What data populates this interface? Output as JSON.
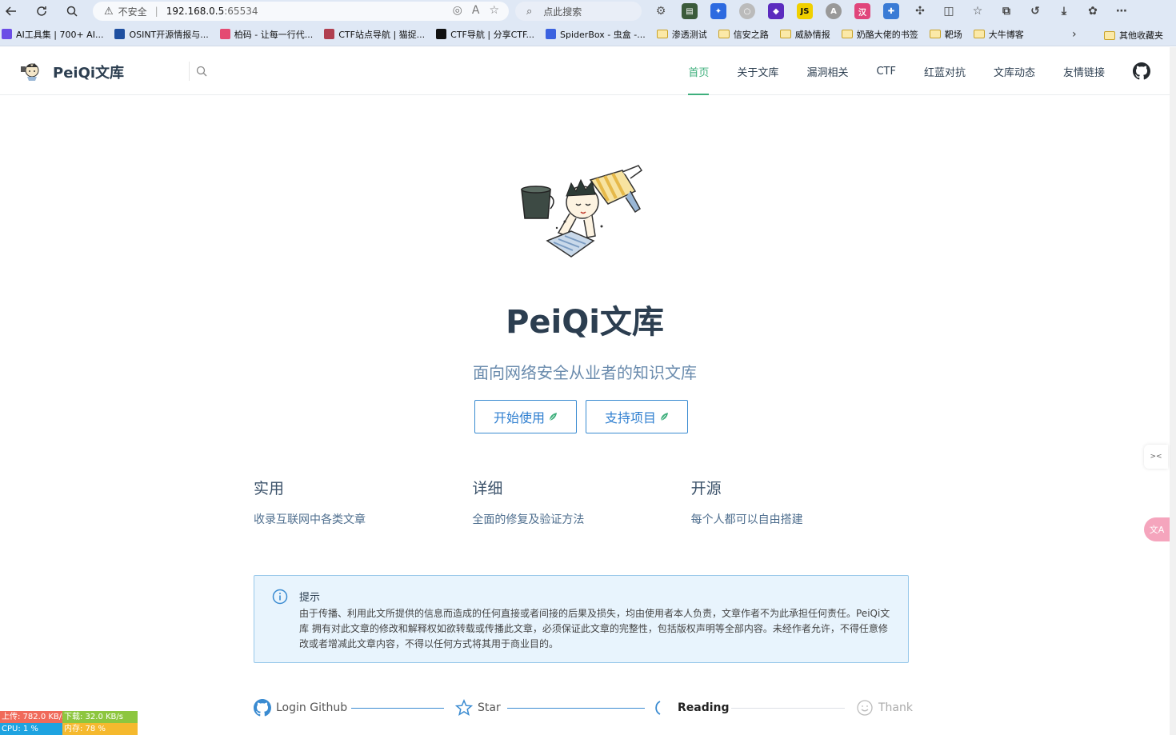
{
  "browser": {
    "security_label": "不安全",
    "url_host": "192.168.0.5",
    "url_port": ":65534",
    "search_placeholder": "点此搜索",
    "bookmarks": [
      {
        "label": "AI工具集 | 700+ AI...",
        "color": "#6b4de6"
      },
      {
        "label": "OSINT开源情报与...",
        "color": "#1e4fa0"
      },
      {
        "label": "柏码 - 让每一行代...",
        "color": "#e44b72"
      },
      {
        "label": "CTF站点导航 | 猫捉...",
        "color": "#b04050"
      },
      {
        "label": "CTF导航 | 分享CTF...",
        "color": "#111111"
      },
      {
        "label": "SpiderBox - 虫盒 -...",
        "color": "#3b62e0"
      }
    ],
    "folders": [
      "渗透测试",
      "信安之路",
      "威胁情报",
      "奶酪大佬的书签",
      "靶场",
      "大牛博客"
    ],
    "other_bookmarks": "其他收藏夹"
  },
  "header": {
    "site_title": "PeiQi文库",
    "nav": [
      "首页",
      "关于文库",
      "漏洞相关",
      "CTF",
      "红蓝对抗",
      "文库动态",
      "友情链接"
    ]
  },
  "hero": {
    "title": "PeiQi文库",
    "description": "面向网络安全从业者的知识文库",
    "buttons": [
      "开始使用",
      "支持项目"
    ]
  },
  "features": [
    {
      "title": "实用",
      "details": "收录互联网中各类文章"
    },
    {
      "title": "详细",
      "details": "全面的修复及验证方法"
    },
    {
      "title": "开源",
      "details": "每个人都可以自由搭建"
    }
  ],
  "tip": {
    "title": "提示",
    "text": "由于传播、利用此文所提供的信息而造成的任何直接或者间接的后果及损失，均由使用者本人负责，文章作者不为此承担任何责任。PeiQi文库 拥有对此文章的修改和解释权如欲转载或传播此文章，必须保证此文章的完整性，包括版权声明等全部内容。未经作者允许，不得任意修改或者增减此文章内容，不得以任何方式将其用于商业目的。"
  },
  "steps": [
    "Login Github",
    "Star",
    "Reading",
    "Thank"
  ],
  "net_monitor": {
    "upload": "上传: 782.0 KB/s",
    "download": "下载: 32.0 KB/s",
    "cpu": "CPU: 1 %",
    "memory": "内存: 78 %"
  },
  "colors": {
    "accent": "#3eaf7c",
    "button_blue": "#3a8bd1",
    "tip_bg": "#e8f4fd"
  }
}
